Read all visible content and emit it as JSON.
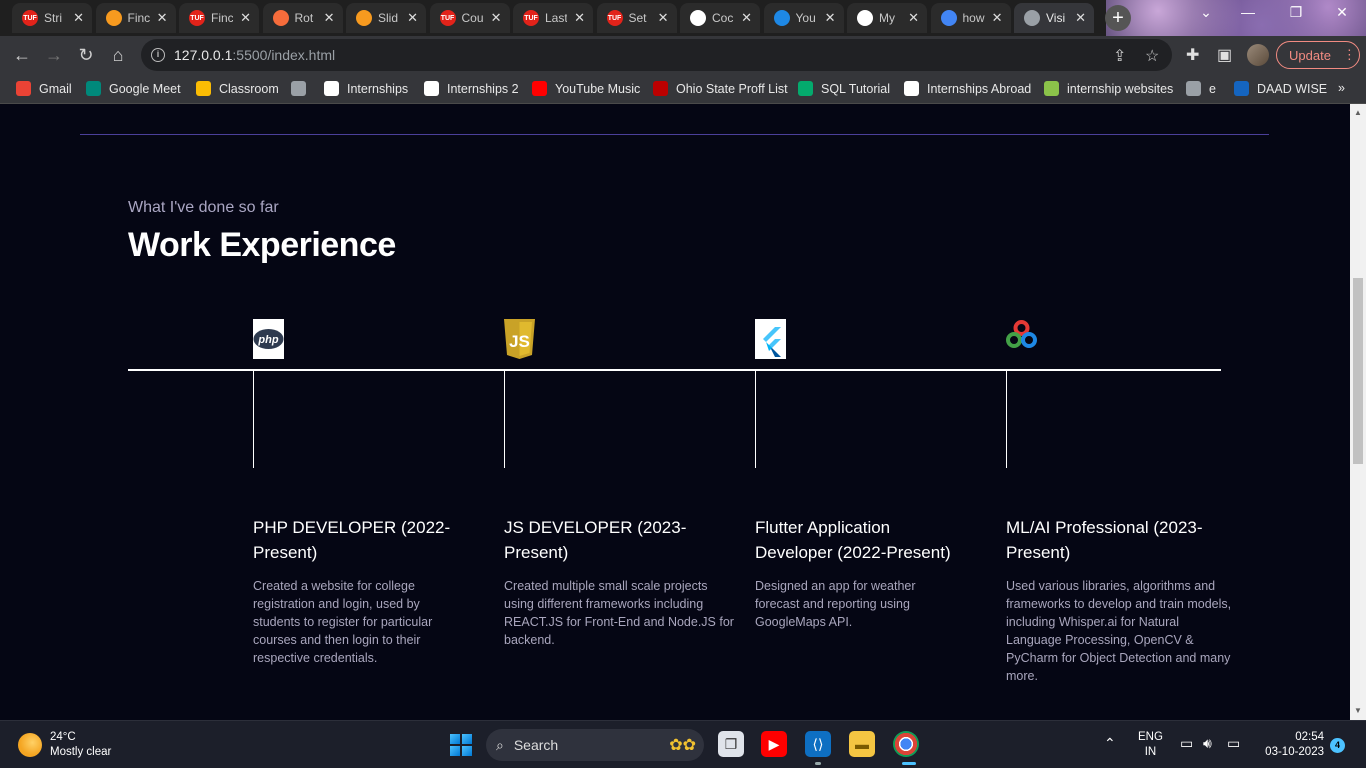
{
  "browser": {
    "tabs": [
      {
        "title": "Stri",
        "favicon": "tuf-icon",
        "color": "#e2231a"
      },
      {
        "title": "Finc",
        "favicon": "codestudio-icon",
        "color": "#f79a1f"
      },
      {
        "title": "Finc",
        "favicon": "tuf-icon",
        "color": "#e2231a"
      },
      {
        "title": "Rot",
        "favicon": "codingninjas-icon",
        "color": "#f66c3b"
      },
      {
        "title": "Slid",
        "favicon": "codestudio-icon",
        "color": "#f79a1f"
      },
      {
        "title": "Cou",
        "favicon": "tuf-icon",
        "color": "#e2231a"
      },
      {
        "title": "Last",
        "favicon": "tuf-icon",
        "color": "#e2231a"
      },
      {
        "title": "Set",
        "favicon": "tuf-icon",
        "color": "#e2231a"
      },
      {
        "title": "Coc",
        "favicon": "github-icon",
        "color": "#ffffff"
      },
      {
        "title": "You",
        "favicon": "s-icon",
        "color": "#1e88e5"
      },
      {
        "title": "My",
        "favicon": "github-icon",
        "color": "#ffffff"
      },
      {
        "title": "how",
        "favicon": "google-icon",
        "color": "#4285f4"
      },
      {
        "title": "Visi",
        "favicon": "globe-icon",
        "color": "#9aa0a6"
      }
    ],
    "fav_text": "TUF",
    "active_tab_index": 12,
    "url_host": "127.0.0.1",
    "url_rest": ":5500/index.html",
    "update_label": "Update",
    "bookmarks": [
      {
        "label": "Gmail",
        "icon": "gmail-icon",
        "color": "#ea4335"
      },
      {
        "label": "Google Meet",
        "icon": "meet-icon",
        "color": "#00897b"
      },
      {
        "label": "Classroom",
        "icon": "classroom-icon",
        "color": "#fbbc04"
      },
      {
        "label": "",
        "icon": "globe-icon",
        "color": "#9aa0a6"
      },
      {
        "label": "Internships",
        "icon": "github-icon",
        "color": "#ffffff"
      },
      {
        "label": "Internships 2",
        "icon": "medium-icon",
        "color": "#ffffff"
      },
      {
        "label": "YouTube Music",
        "icon": "youtube-music-icon",
        "color": "#ff0000"
      },
      {
        "label": "Ohio State Proff List",
        "icon": "ohio-state-icon",
        "color": "#bb0000"
      },
      {
        "label": "SQL Tutorial",
        "icon": "w3schools-icon",
        "color": "#04aa6d"
      },
      {
        "label": "Internships Abroad",
        "icon": "github-icon",
        "color": "#ffffff"
      },
      {
        "label": "internship websites",
        "icon": "sheets-icon",
        "color": "#8bc34a"
      },
      {
        "label": "e",
        "icon": "globe-icon",
        "color": "#9aa0a6"
      },
      {
        "label": "DAAD WISE",
        "icon": "d-icon",
        "color": "#1565c0"
      }
    ],
    "more_bookmarks": "»"
  },
  "section": {
    "subtitle": "What I've done so far",
    "title": "Work Experience"
  },
  "experiences": [
    {
      "icon": "php-icon",
      "title": "PHP DEVELOPER (2022-Present)",
      "description": "Created a website for college registration and login, used by students to register for particular courses and then login to their respective credentials."
    },
    {
      "icon": "javascript-icon",
      "title": "JS DEVELOPER (2023-Present)",
      "description": "Created multiple small scale projects using different frameworks including REACT.JS for Front-End and Node.JS for backend."
    },
    {
      "icon": "flutter-icon",
      "title": "Flutter Application Developer (2022-Present)",
      "description": "Designed an app for weather forecast and reporting using GoogleMaps API."
    },
    {
      "icon": "opencv-icon",
      "title": "ML/AI Professional (2023-Present)",
      "description": "Used various libraries, algorithms and frameworks to develop and train models, including Whisper.ai for Natural Language Processing, OpenCV & PyCharm for Object Detection and many more."
    }
  ],
  "taskbar": {
    "temperature": "24°C",
    "weather": "Mostly clear",
    "search_label": "Search",
    "lang_top": "ENG",
    "lang_bottom": "IN",
    "time": "02:54",
    "date": "03-10-2023",
    "notification_count": "4"
  }
}
